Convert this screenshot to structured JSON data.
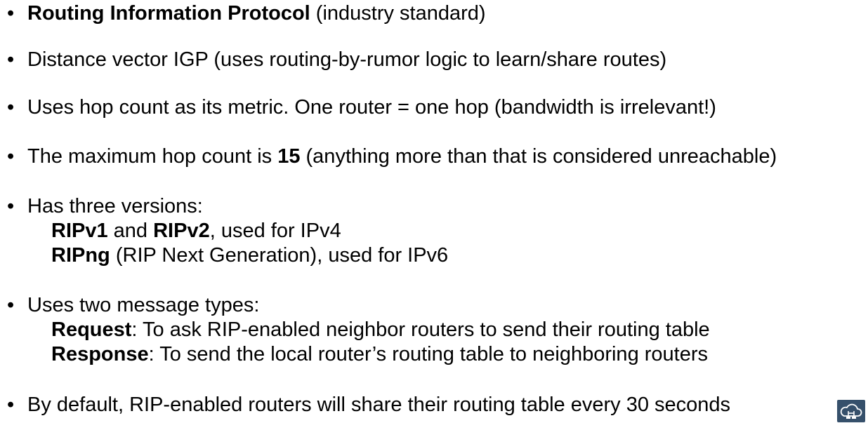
{
  "bullet_char": "•",
  "bullets": [
    {
      "bold": "Routing Information Protocol",
      "text": " (industry standard)"
    },
    {
      "text": "Distance vector IGP (uses routing-by-rumor logic to learn/share routes)"
    },
    {
      "text": "Uses hop count as its metric.  One router = one hop (bandwidth is irrelevant!)"
    },
    {
      "pre": "The maximum hop count is ",
      "bold": "15",
      "post": " (anything more than that is considered unreachable)"
    },
    {
      "text": "Has three versions:"
    },
    {
      "text": "Uses two message types:"
    },
    {
      "text": "By default, RIP-enabled routers will share their routing table every 30 seconds"
    }
  ],
  "versions": {
    "line1": {
      "bold1": "RIPv1",
      "mid": " and ",
      "bold2": "RIPv2",
      "post": ", used for IPv4"
    },
    "line2": {
      "bold": "RIPng",
      "post": " (RIP Next Generation), used for IPv6"
    }
  },
  "messages": {
    "request": {
      "bold": "Request",
      "post": ": To ask RIP-enabled neighbor routers to send their routing table"
    },
    "response": {
      "bold": "Response",
      "post": ": To send the local router’s routing table to neighboring routers"
    }
  },
  "logo": {
    "icon": "cloud-network-icon",
    "color": "#36506b"
  }
}
